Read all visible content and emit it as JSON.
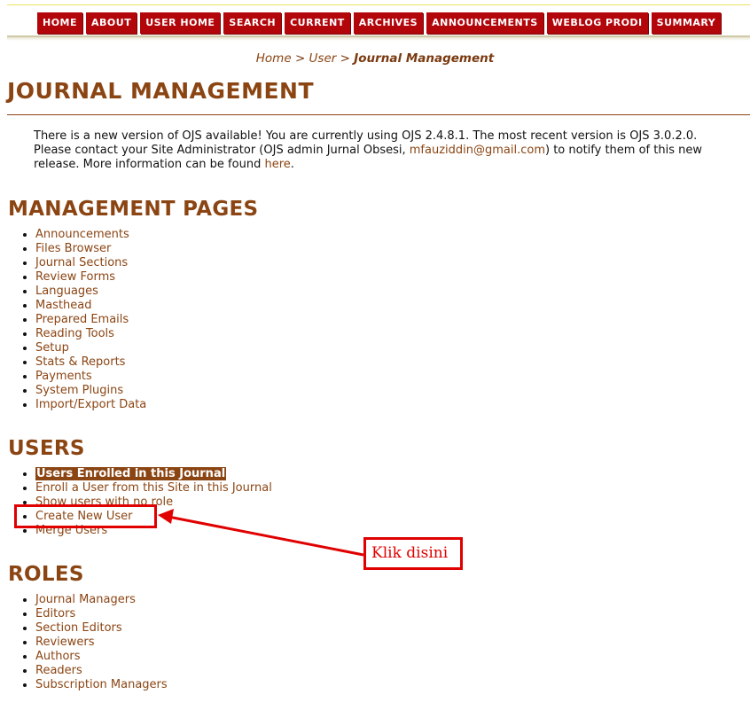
{
  "nav": {
    "items": [
      "HOME",
      "ABOUT",
      "USER HOME",
      "SEARCH",
      "CURRENT",
      "ARCHIVES",
      "ANNOUNCEMENTS",
      "WEBLOG PRODI",
      "SUMMARY"
    ]
  },
  "breadcrumb": {
    "home": "Home",
    "sep1": ">",
    "user": "User",
    "sep2": ">",
    "current": "Journal Management"
  },
  "page": {
    "title": "JOURNAL MANAGEMENT"
  },
  "notice": {
    "text1": "There is a new version of OJS available! You are currently using OJS 2.4.8.1. The most recent version is OJS 3.0.2.0. Please contact your Site Administrator (OJS admin Jurnal Obsesi, ",
    "email": "mfauziddin@gmail.com",
    "text2": ") to notify them of this new release. More information can be found ",
    "link": "here",
    "text3": "."
  },
  "management": {
    "heading": "MANAGEMENT PAGES",
    "items": [
      "Announcements",
      "Files Browser",
      "Journal Sections",
      "Review Forms",
      "Languages",
      "Masthead",
      "Prepared Emails",
      "Reading Tools",
      "Setup",
      "Stats & Reports",
      "Payments",
      "System Plugins",
      "Import/Export Data"
    ]
  },
  "users": {
    "heading": "USERS",
    "items": [
      "Users Enrolled in this Journal",
      "Enroll a User from this Site in this Journal",
      "Show users with no role",
      "Create New User",
      "Merge Users"
    ]
  },
  "roles": {
    "heading": "ROLES",
    "items": [
      "Journal Managers",
      "Editors",
      "Section Editors",
      "Reviewers",
      "Authors",
      "Readers",
      "Subscription Managers"
    ]
  },
  "annotation": {
    "label": "Klik disini",
    "color": "#e00000"
  },
  "colors": {
    "brand": "#8b4513",
    "nav": "#b3060b"
  }
}
